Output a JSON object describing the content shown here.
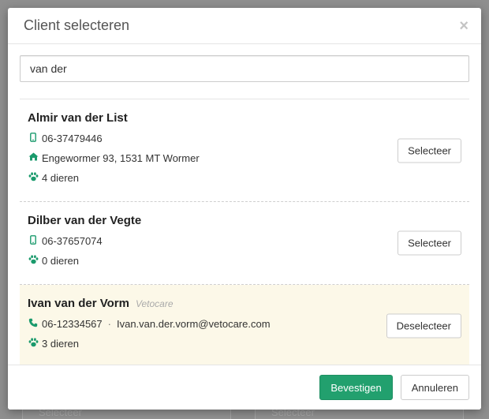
{
  "modal": {
    "title": "Client selecteren",
    "close_symbol": "×"
  },
  "search": {
    "value": "van der",
    "placeholder": ""
  },
  "clients": [
    {
      "name": "Almir van der List",
      "org": "",
      "phone": "06-37479446",
      "phone_icon": "mobile-icon",
      "email": "",
      "address": "Engewormer 93, 1531 MT Wormer",
      "animals": "4 dieren",
      "button": "Selecteer",
      "selected": false
    },
    {
      "name": "Dilber van der Vegte",
      "org": "",
      "phone": "06-37657074",
      "phone_icon": "mobile-icon",
      "email": "",
      "address": "",
      "animals": "0 dieren",
      "button": "Selecteer",
      "selected": false
    },
    {
      "name": "Ivan van der Vorm",
      "org": "Vetocare",
      "phone": "06-12334567",
      "phone_icon": "phone-icon",
      "separator": "·",
      "email": "Ivan.van.der.vorm@vetocare.com",
      "address": "",
      "animals": "3 dieren",
      "button": "Deselecteer",
      "selected": true
    }
  ],
  "footer": {
    "confirm_label": "Bevestigen",
    "cancel_label": "Annuleren"
  },
  "background": {
    "ghost_buttons": [
      "Selecteer",
      "Selecteer"
    ]
  },
  "colors": {
    "accent": "#22a06e",
    "icon": "#1a9a6c",
    "selected_row": "#fcf8e8"
  }
}
